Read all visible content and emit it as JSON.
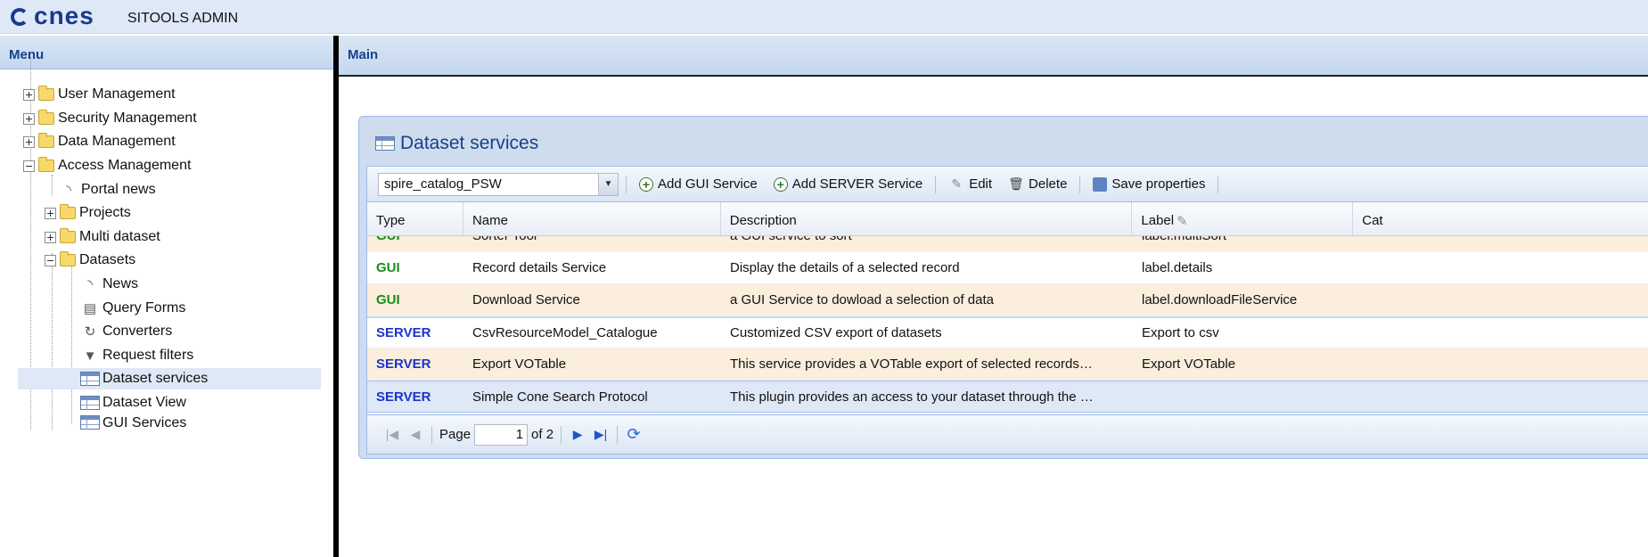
{
  "header": {
    "logo_text": "cnes",
    "app_title": "SITOOLS ADMIN"
  },
  "menu": {
    "title": "Menu",
    "tree": [
      {
        "label": "User Management",
        "type": "folder",
        "expanded": false
      },
      {
        "label": "Security Management",
        "type": "folder",
        "expanded": false
      },
      {
        "label": "Data Management",
        "type": "folder",
        "expanded": false
      },
      {
        "label": "Access Management",
        "type": "folder",
        "expanded": true
      },
      {
        "label": "Portal news",
        "type": "leaf",
        "icon": "rss-icon"
      },
      {
        "label": "Projects",
        "type": "folder",
        "expanded": false
      },
      {
        "label": "Multi dataset",
        "type": "folder",
        "expanded": false
      },
      {
        "label": "Datasets",
        "type": "folder",
        "expanded": true
      },
      {
        "label": "News",
        "type": "leaf",
        "icon": "rss-icon"
      },
      {
        "label": "Query Forms",
        "type": "leaf",
        "icon": "form-icon"
      },
      {
        "label": "Converters",
        "type": "leaf",
        "icon": "converter-icon"
      },
      {
        "label": "Request filters",
        "type": "leaf",
        "icon": "filter-icon"
      },
      {
        "label": "Dataset services",
        "type": "leaf",
        "icon": "grid-icon",
        "selected": true
      },
      {
        "label": "Dataset View",
        "type": "leaf",
        "icon": "grid-icon"
      },
      {
        "label": "GUI Services",
        "type": "leaf",
        "icon": "grid-icon"
      }
    ]
  },
  "main": {
    "title": "Main",
    "window": {
      "title": "Dataset services",
      "toolbar": {
        "dataset_select": "spire_catalog_PSW",
        "add_gui": "Add GUI Service",
        "add_server": "Add SERVER Service",
        "edit": "Edit",
        "delete": "Delete",
        "save": "Save properties"
      },
      "columns": [
        "Type",
        "Name",
        "Description",
        "Label",
        "Cat"
      ],
      "rows": [
        {
          "type": "GUI",
          "name": "Sorter Tool",
          "description": "a GUI service to sort",
          "label": "label.multiSort"
        },
        {
          "type": "GUI",
          "name": "Record details Service",
          "description": "Display the details of a selected record",
          "label": "label.details"
        },
        {
          "type": "GUI",
          "name": "Download Service",
          "description": "a GUI Service to dowload a selection of data",
          "label": "label.downloadFileService"
        },
        {
          "type": "SERVER",
          "name": "CsvResourceModel_Catalogue",
          "description": "Customized CSV export of datasets",
          "label": "Export to csv"
        },
        {
          "type": "SERVER",
          "name": "Export VOTable",
          "description": "This service provides a VOTable export of selected records…",
          "label": "Export VOTable"
        },
        {
          "type": "SERVER",
          "name": "Simple Cone Search Protocol",
          "description": "This plugin provides an access to your dataset through the …",
          "label": ""
        }
      ],
      "paging": {
        "page_label": "Page",
        "page_value": "1",
        "of_label": "of 2"
      }
    }
  }
}
